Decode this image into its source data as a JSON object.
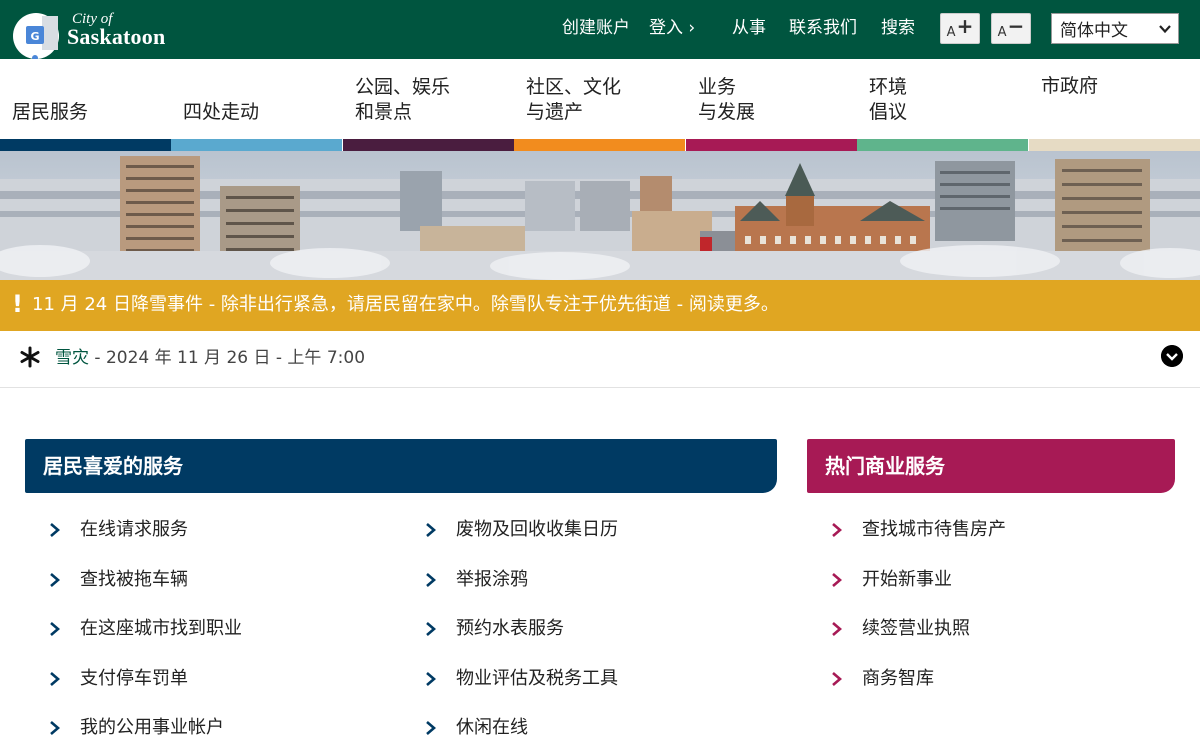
{
  "header": {
    "logo": {
      "line1": "City of",
      "line2": "Saskatoon"
    },
    "links": [
      "创建账户",
      "登入 ›",
      "从事",
      "联系我们",
      "搜索"
    ],
    "font_increase_label": "A",
    "font_decrease_label": "A",
    "language": "简体中文"
  },
  "nav": {
    "items": [
      {
        "label": "居民服务",
        "color": "#003a63"
      },
      {
        "label": "四处走动",
        "color": "#5aa9cf"
      },
      {
        "label": "公园、娱乐\n和景点",
        "color": "#4a1d3f"
      },
      {
        "label": "社区、文化\n与遗产",
        "color": "#f28c1e"
      },
      {
        "label": "业务\n与发展",
        "color": "#a71a55"
      },
      {
        "label": "环境\n倡议",
        "color": "#5fb48c"
      },
      {
        "label": "市政府",
        "color": "#e6dbc4"
      }
    ]
  },
  "alert": {
    "icon": "!",
    "message": "11 月 24 日降雪事件 - 除非出行紧急，请居民留在家中。除雪队专注于优先街道 - 阅读更多。"
  },
  "notice": {
    "title": "雪灾",
    "date": " - 2024 年 11 月 26 日 - 上午 7:00"
  },
  "resident_services": {
    "title": "居民喜爱的服务",
    "left": [
      "在线请求服务",
      "查找被拖车辆",
      "在这座城市找到职业",
      "支付停车罚单",
      "我的公用事业帐户"
    ],
    "right": [
      "废物及回收收集日历",
      "举报涂鸦",
      "预约水表服务",
      "物业评估及税务工具",
      "休闲在线"
    ]
  },
  "business_services": {
    "title": "热门商业服务",
    "items": [
      "查找城市待售房产",
      "开始新事业",
      "续签营业执照",
      "商务智库"
    ]
  },
  "colors": {
    "header_green": "#00553f",
    "alert_gold": "#e0a622",
    "resident_blue": "#003a63",
    "business_magenta": "#a71a55"
  }
}
